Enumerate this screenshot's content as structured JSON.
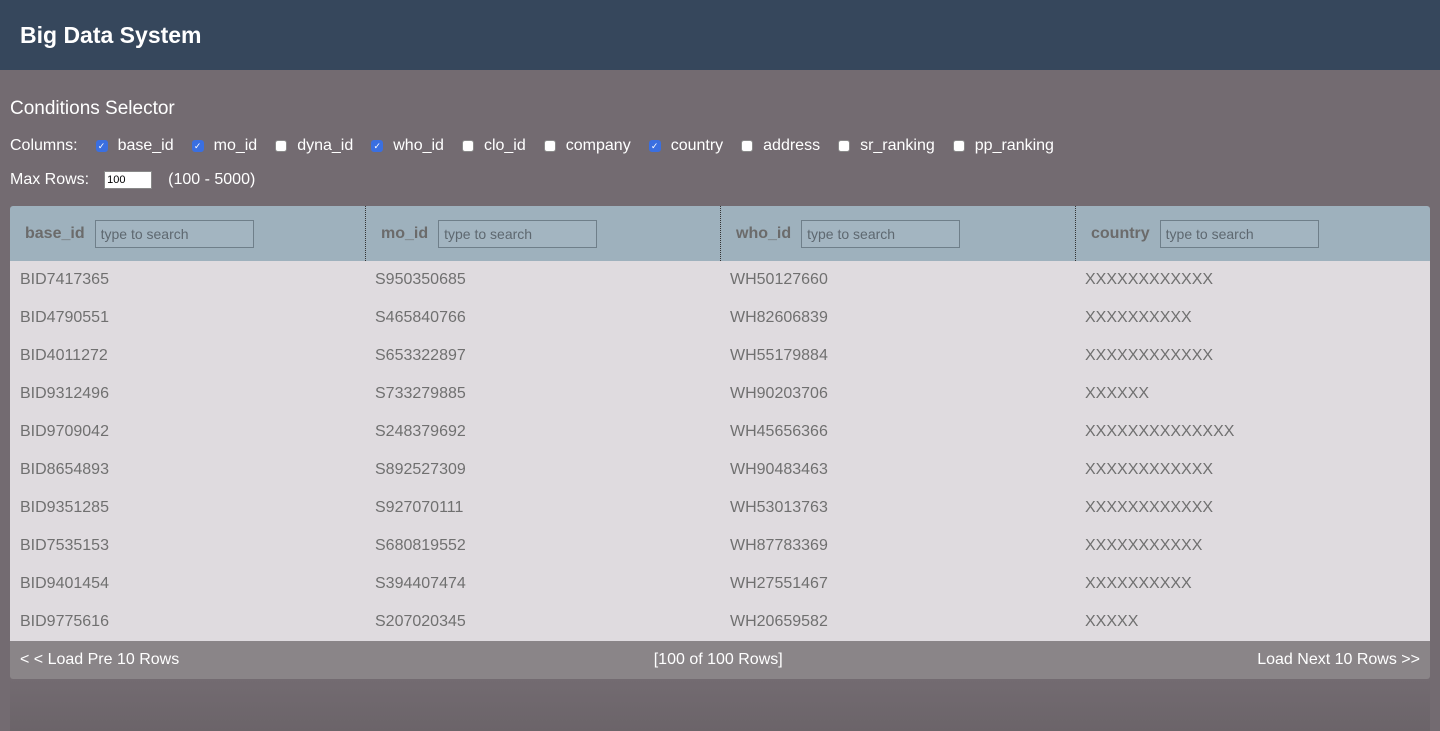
{
  "header": {
    "title": "Big Data System"
  },
  "conditions": {
    "title": "Conditions Selector",
    "columns_label": "Columns:",
    "columns": [
      {
        "label": "base_id",
        "checked": true
      },
      {
        "label": "mo_id",
        "checked": true
      },
      {
        "label": "dyna_id",
        "checked": false
      },
      {
        "label": "who_id",
        "checked": true
      },
      {
        "label": "clo_id",
        "checked": false
      },
      {
        "label": "company",
        "checked": false
      },
      {
        "label": "country",
        "checked": true
      },
      {
        "label": "address",
        "checked": false
      },
      {
        "label": "sr_ranking",
        "checked": false
      },
      {
        "label": "pp_ranking",
        "checked": false
      }
    ],
    "max_rows_label": "Max Rows:",
    "max_rows_value": "100",
    "max_rows_range": "(100 - 5000)"
  },
  "table": {
    "search_placeholder": "type to search",
    "headers": [
      "base_id",
      "mo_id",
      "who_id",
      "country"
    ],
    "rows": [
      [
        "BID7417365",
        "S950350685",
        "WH50127660",
        "XXXXXXXXXXXX"
      ],
      [
        "BID4790551",
        "S465840766",
        "WH82606839",
        "XXXXXXXXXX"
      ],
      [
        "BID4011272",
        "S653322897",
        "WH55179884",
        "XXXXXXXXXXXX"
      ],
      [
        "BID9312496",
        "S733279885",
        "WH90203706",
        "XXXXXX"
      ],
      [
        "BID9709042",
        "S248379692",
        "WH45656366",
        "XXXXXXXXXXXXXX"
      ],
      [
        "BID8654893",
        "S892527309",
        "WH90483463",
        "XXXXXXXXXXXX"
      ],
      [
        "BID9351285",
        "S927070111",
        "WH53013763",
        "XXXXXXXXXXXX"
      ],
      [
        "BID7535153",
        "S680819552",
        "WH87783369",
        "XXXXXXXXXXX"
      ],
      [
        "BID9401454",
        "S394407474",
        "WH27551467",
        "XXXXXXXXXX"
      ],
      [
        "BID9775616",
        "S207020345",
        "WH20659582",
        "XXXXX"
      ]
    ]
  },
  "pager": {
    "prev_label": "< < Load Pre 10 Rows",
    "status": "[100 of 100 Rows]",
    "next_label": "Load Next 10 Rows >>"
  }
}
